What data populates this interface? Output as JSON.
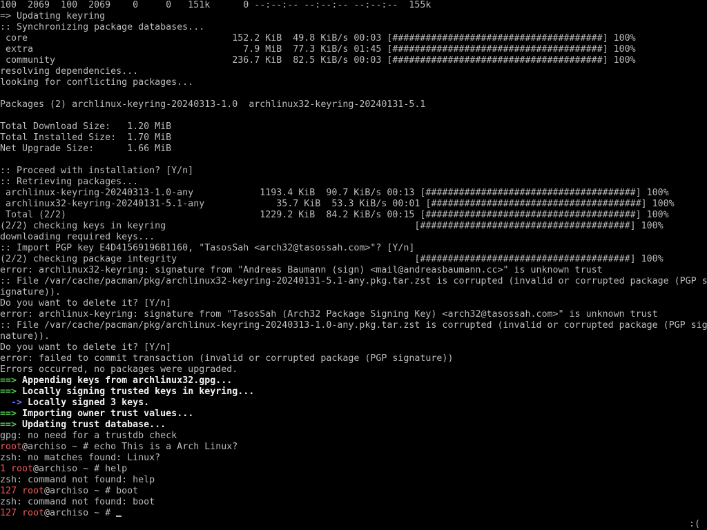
{
  "terminal": {
    "lines": [
      [
        {
          "t": "100  2069  100  2069    0     0   151k      0 --:--:-- --:--:-- --:--:--  155k",
          "c": "default"
        }
      ],
      [
        {
          "t": "=> Updating keyring",
          "c": "default"
        }
      ],
      [
        {
          "t": ":: Synchronizing package databases...",
          "c": "default"
        }
      ],
      [
        {
          "t": " core                                     152.2 KiB  49.8 KiB/s 00:03 [######################################] 100%",
          "c": "default"
        }
      ],
      [
        {
          "t": " extra                                      7.9 MiB  77.3 KiB/s 01:45 [######################################] 100%",
          "c": "default"
        }
      ],
      [
        {
          "t": " community                                236.7 KiB  82.5 KiB/s 00:03 [######################################] 100%",
          "c": "default"
        }
      ],
      [
        {
          "t": "resolving dependencies...",
          "c": "default"
        }
      ],
      [
        {
          "t": "looking for conflicting packages...",
          "c": "default"
        }
      ],
      [
        {
          "t": "",
          "c": "default"
        }
      ],
      [
        {
          "t": "Packages (2) archlinux-keyring-20240313-1.0  archlinux32-keyring-20240131-5.1",
          "c": "default"
        }
      ],
      [
        {
          "t": "",
          "c": "default"
        }
      ],
      [
        {
          "t": "Total Download Size:   1.20 MiB",
          "c": "default"
        }
      ],
      [
        {
          "t": "Total Installed Size:  1.70 MiB",
          "c": "default"
        }
      ],
      [
        {
          "t": "Net Upgrade Size:      1.66 MiB",
          "c": "default"
        }
      ],
      [
        {
          "t": "",
          "c": "default"
        }
      ],
      [
        {
          "t": ":: Proceed with installation? [Y/n]",
          "c": "default"
        }
      ],
      [
        {
          "t": ":: Retrieving packages...",
          "c": "default"
        }
      ],
      [
        {
          "t": " archlinux-keyring-20240313-1.0-any            1193.4 KiB  90.7 KiB/s 00:13 [######################################] 100%",
          "c": "default"
        }
      ],
      [
        {
          "t": " archlinux32-keyring-20240131-5.1-any             35.7 KiB  53.3 KiB/s 00:01 [######################################] 100%",
          "c": "default"
        }
      ],
      [
        {
          "t": " Total (2/2)                                   1229.2 KiB  84.2 KiB/s 00:15 [######################################] 100%",
          "c": "default"
        }
      ],
      [
        {
          "t": "(2/2) checking keys in keyring                                             [######################################] 100%",
          "c": "default"
        }
      ],
      [
        {
          "t": "downloading required keys...",
          "c": "default"
        }
      ],
      [
        {
          "t": ":: Import PGP key E4D41569196B1160, \"TasosSah <arch32@tasossah.com>\"? [Y/n]",
          "c": "default"
        }
      ],
      [
        {
          "t": "(2/2) checking package integrity                                           [######################################] 100%",
          "c": "default"
        }
      ],
      [
        {
          "t": "error: archlinux32-keyring: signature from \"Andreas Baumann (sign) <mail@andreasbaumann.cc>\" is unknown trust",
          "c": "default"
        }
      ],
      [
        {
          "t": ":: File /var/cache/pacman/pkg/archlinux32-keyring-20240131-5.1-any.pkg.tar.zst is corrupted (invalid or corrupted package (PGP s",
          "c": "default"
        }
      ],
      [
        {
          "t": "ignature)).",
          "c": "default"
        }
      ],
      [
        {
          "t": "Do you want to delete it? [Y/n]",
          "c": "default"
        }
      ],
      [
        {
          "t": "error: archlinux-keyring: signature from \"TasosSah (Arch32 Package Signing Key) <arch32@tasossah.com>\" is unknown trust",
          "c": "default"
        }
      ],
      [
        {
          "t": ":: File /var/cache/pacman/pkg/archlinux-keyring-20240313-1.0-any.pkg.tar.zst is corrupted (invalid or corrupted package (PGP sig",
          "c": "default"
        }
      ],
      [
        {
          "t": "nature)).",
          "c": "default"
        }
      ],
      [
        {
          "t": "Do you want to delete it? [Y/n]",
          "c": "default"
        }
      ],
      [
        {
          "t": "error: failed to commit transaction (invalid or corrupted package (PGP signature))",
          "c": "default"
        }
      ],
      [
        {
          "t": "Errors occurred, no packages were upgraded.",
          "c": "default"
        }
      ],
      [
        {
          "t": "==>",
          "c": "green"
        },
        {
          "t": " Appending keys from archlinux32.gpg...",
          "c": "bold"
        }
      ],
      [
        {
          "t": "==>",
          "c": "green"
        },
        {
          "t": " Locally signing trusted keys in keyring...",
          "c": "bold"
        }
      ],
      [
        {
          "t": "  ->",
          "c": "blue"
        },
        {
          "t": " Locally signed 3 keys.",
          "c": "bold"
        }
      ],
      [
        {
          "t": "==>",
          "c": "green"
        },
        {
          "t": " Importing owner trust values...",
          "c": "bold"
        }
      ],
      [
        {
          "t": "==>",
          "c": "green"
        },
        {
          "t": " Updating trust database...",
          "c": "bold"
        }
      ],
      [
        {
          "t": "gpg: no need for a trustdb check",
          "c": "default"
        }
      ],
      [
        {
          "t": "root",
          "c": "red"
        },
        {
          "t": "@archiso ~ # echo This is a Arch Linux?",
          "c": "default"
        }
      ],
      [
        {
          "t": "zsh: no matches found: Linux?",
          "c": "default"
        }
      ],
      [
        {
          "t": "1 root",
          "c": "red"
        },
        {
          "t": "@archiso ~ # help",
          "c": "default"
        }
      ],
      [
        {
          "t": "zsh: command not found: help",
          "c": "default"
        }
      ],
      [
        {
          "t": "127 root",
          "c": "red"
        },
        {
          "t": "@archiso ~ # boot",
          "c": "default"
        }
      ],
      [
        {
          "t": "zsh: command not found: boot",
          "c": "default"
        }
      ],
      [
        {
          "t": "127 root",
          "c": "red"
        },
        {
          "t": "@archiso ~ # ",
          "c": "default"
        }
      ]
    ],
    "status_indicator": ":("
  }
}
